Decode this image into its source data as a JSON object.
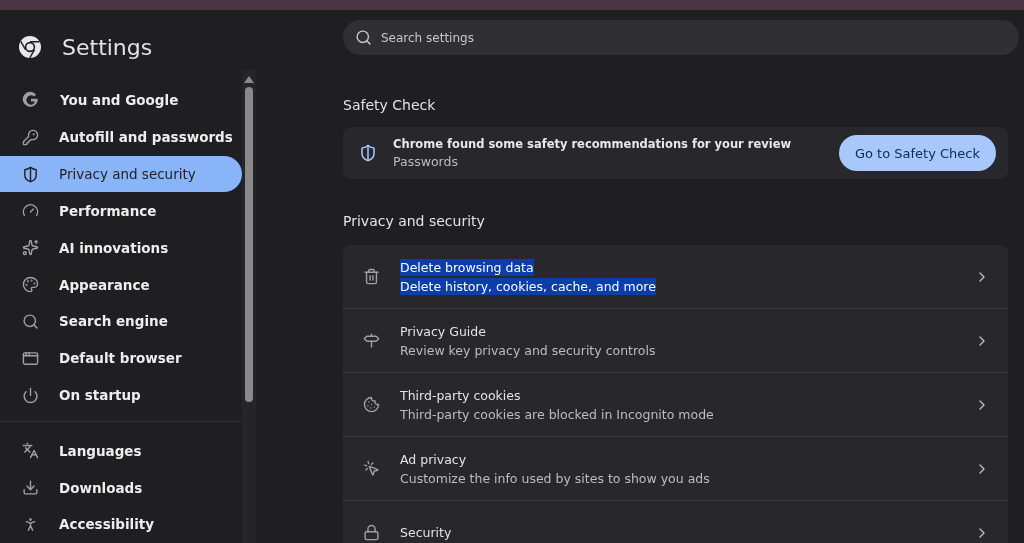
{
  "header": {
    "title": "Settings"
  },
  "search": {
    "placeholder": "Search settings"
  },
  "sidebar": {
    "items": [
      {
        "label": "You and Google",
        "selected": false
      },
      {
        "label": "Autofill and passwords",
        "selected": false
      },
      {
        "label": "Privacy and security",
        "selected": true
      },
      {
        "label": "Performance",
        "selected": false
      },
      {
        "label": "AI innovations",
        "selected": false
      },
      {
        "label": "Appearance",
        "selected": false
      },
      {
        "label": "Search engine",
        "selected": false
      },
      {
        "label": "Default browser",
        "selected": false
      },
      {
        "label": "On startup",
        "selected": false
      }
    ],
    "advanced_items": [
      {
        "label": "Languages",
        "selected": false
      },
      {
        "label": "Downloads",
        "selected": false
      },
      {
        "label": "Accessibility",
        "selected": false
      }
    ]
  },
  "safety_check": {
    "heading": "Safety Check",
    "message": "Chrome found some safety recommendations for your review",
    "detail": "Passwords",
    "button": "Go to Safety Check"
  },
  "privacy": {
    "heading": "Privacy and security",
    "rows": [
      {
        "title": "Delete browsing data",
        "subtitle": "Delete history, cookies, cache, and more",
        "highlighted": true
      },
      {
        "title": "Privacy Guide",
        "subtitle": "Review key privacy and security controls",
        "highlighted": false
      },
      {
        "title": "Third-party cookies",
        "subtitle": "Third-party cookies are blocked in Incognito mode",
        "highlighted": false
      },
      {
        "title": "Ad privacy",
        "subtitle": "Customize the info used by sites to show you ads",
        "highlighted": false
      },
      {
        "title": "Security",
        "highlighted": false
      }
    ]
  }
}
